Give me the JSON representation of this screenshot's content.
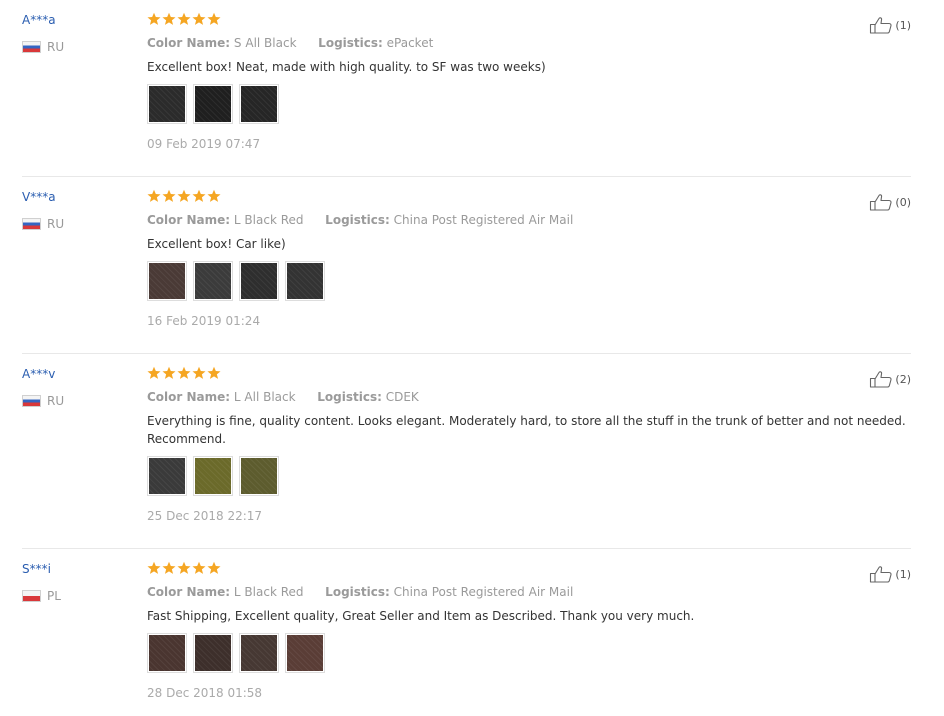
{
  "labels": {
    "color_name": "Color Name:",
    "logistics": "Logistics:"
  },
  "colors": {
    "star": "#f5a623",
    "username": "#2a5db0"
  },
  "reviews": [
    {
      "user": "A***a",
      "country": "RU",
      "flag": "ru",
      "rating": 5,
      "color_name": "S All Black",
      "logistics": "ePacket",
      "text": "Excellent box! Neat, made with high quality. to SF was two weeks)",
      "photos": [
        "#2b2b2b",
        "#1f1f1f",
        "#262626"
      ],
      "date": "09 Feb 2019 07:47",
      "helpful": "(1)"
    },
    {
      "user": "V***a",
      "country": "RU",
      "flag": "ru",
      "rating": 5,
      "color_name": "L Black Red",
      "logistics": "China Post Registered Air Mail",
      "text": "Excellent box! Car like)",
      "photos": [
        "#4a3a36",
        "#3b3b3b",
        "#2e2e2e",
        "#333333"
      ],
      "date": "16 Feb 2019 01:24",
      "helpful": "(0)"
    },
    {
      "user": "A***v",
      "country": "RU",
      "flag": "ru",
      "rating": 5,
      "color_name": "L All Black",
      "logistics": "CDEK",
      "text": "Everything is fine, quality content. Looks elegant. Moderately hard, to store all the stuff in the trunk of better and not needed. Recommend.",
      "photos": [
        "#3a3a3a",
        "#6b6a2a",
        "#5d5c2e"
      ],
      "date": "25 Dec 2018 22:17",
      "helpful": "(2)"
    },
    {
      "user": "S***i",
      "country": "PL",
      "flag": "pl",
      "rating": 5,
      "color_name": "L Black Red",
      "logistics": "China Post Registered Air Mail",
      "text": "Fast Shipping, Excellent quality, Great Seller and Item as Described. Thank you very much.",
      "photos": [
        "#4a3530",
        "#3d2f2b",
        "#463833",
        "#5a3d36"
      ],
      "date": "28 Dec 2018 01:58",
      "helpful": "(1)"
    }
  ]
}
